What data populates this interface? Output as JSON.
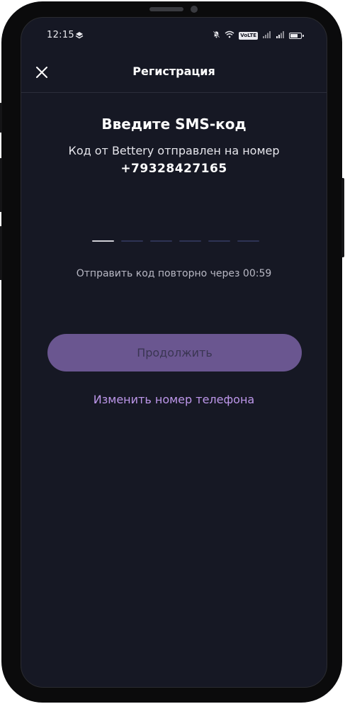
{
  "status_bar": {
    "time": "12:15",
    "volte_label": "VoLTE"
  },
  "header": {
    "title": "Регистрация"
  },
  "main": {
    "title": "Введите SMS-код",
    "subtitle": "Код от Bettery отправлен на номер",
    "phone_number": "+79328427165",
    "code_length": 6,
    "resend_text": "Отправить код повторно через 00:59",
    "continue_label": "Продолжить",
    "change_phone_label": "Изменить номер телефона"
  },
  "colors": {
    "background": "#161824",
    "accent_button": "#6a5690",
    "link": "#bd97ea"
  },
  "icons": {
    "close": "close-icon",
    "status_left": "layers-icon",
    "mute": "bell-off-icon",
    "wifi": "wifi-icon",
    "signal": "signal-icon",
    "battery": "battery-icon"
  }
}
